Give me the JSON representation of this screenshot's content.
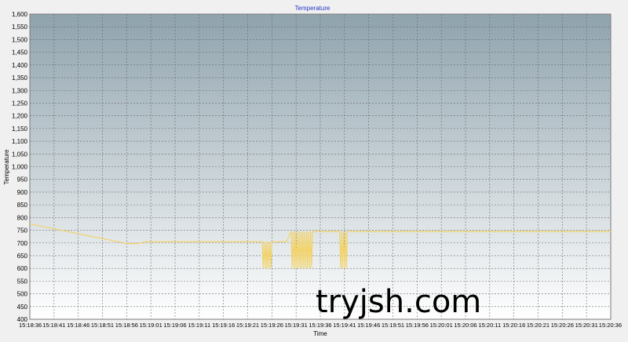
{
  "chart_data": {
    "type": "line",
    "title": "Temperature",
    "xlabel": "Time",
    "ylabel": "Temperature",
    "ylim": [
      400,
      1600
    ],
    "y_ticks": [
      "400",
      "450",
      "500",
      "550",
      "600",
      "650",
      "700",
      "750",
      "800",
      "850",
      "900",
      "950",
      "1,000",
      "1,050",
      "1,100",
      "1,150",
      "1,200",
      "1,250",
      "1,300",
      "1,350",
      "1,400",
      "1,450",
      "1,500",
      "1,550",
      "1,600"
    ],
    "x_range_seconds": [
      "15:18:36",
      "15:20:36"
    ],
    "x_ticks": [
      "15:18:36",
      "15:18:41",
      "15:18:46",
      "15:18:51",
      "15:18:56",
      "15:19:01",
      "15:19:06",
      "15:19:11",
      "15:19:16",
      "15:19:21",
      "15:19:26",
      "15:19:31",
      "15:19:36",
      "15:19:41",
      "15:19:46",
      "15:19:51",
      "15:19:56",
      "15:20:01",
      "15:20:06",
      "15:20:11",
      "15:20:16",
      "15:20:21",
      "15:20:26",
      "15:20:31",
      "15:20:36"
    ],
    "grid": true,
    "colors": {
      "series": "#f2d36b",
      "title": "#2a36c8",
      "plot_top": "#8fa3ad",
      "plot_bottom": "#ffffff"
    },
    "series": [
      {
        "x": [
          "15:18:36",
          "15:18:56",
          "15:18:58",
          "15:18:59",
          "15:19:00",
          "15:19:24",
          "15:19:24.2",
          "15:19:24.4",
          "15:19:24.6",
          "15:19:24.8",
          "15:19:25",
          "15:19:25.2",
          "15:19:25.4",
          "15:19:25.6",
          "15:19:25.8",
          "15:19:26",
          "15:19:26.5",
          "15:19:29",
          "15:19:30",
          "15:19:30.2",
          "15:19:30.4",
          "15:19:30.6",
          "15:19:30.8",
          "15:19:31",
          "15:19:31.2",
          "15:19:31.4",
          "15:19:31.6",
          "15:19:31.8",
          "15:19:32",
          "15:19:32.2",
          "15:19:32.4",
          "15:19:32.6",
          "15:19:32.8",
          "15:19:33",
          "15:19:33.2",
          "15:19:33.4",
          "15:19:33.6",
          "15:19:33.8",
          "15:19:34",
          "15:19:34.2",
          "15:19:34.4",
          "15:19:35",
          "15:19:40",
          "15:19:40.2",
          "15:19:40.4",
          "15:19:40.6",
          "15:19:40.8",
          "15:19:41",
          "15:19:41.2",
          "15:19:41.4",
          "15:19:41.6",
          "15:19:42",
          "15:20:36"
        ],
        "y": [
          775,
          698,
          697,
          700,
          705,
          705,
          600,
          705,
          600,
          705,
          600,
          705,
          600,
          705,
          600,
          705,
          705,
          705,
          745,
          600,
          745,
          600,
          745,
          600,
          745,
          600,
          745,
          600,
          745,
          600,
          745,
          600,
          745,
          600,
          745,
          600,
          745,
          600,
          745,
          600,
          745,
          745,
          745,
          600,
          745,
          600,
          745,
          600,
          745,
          600,
          745,
          745,
          745
        ]
      }
    ]
  },
  "watermark": "tryjsh.com"
}
